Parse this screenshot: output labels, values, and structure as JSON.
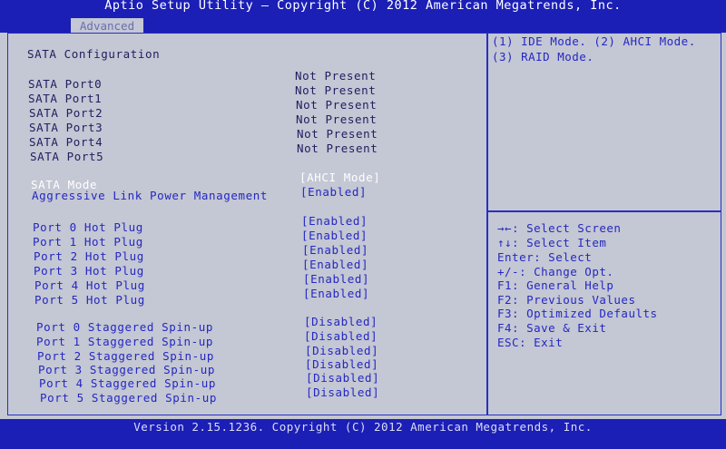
{
  "header": {
    "title": "Aptio Setup Utility – Copyright (C) 2012 American Megatrends, Inc.",
    "tab": "Advanced"
  },
  "main": {
    "section_title": "SATA Configuration",
    "ports": [
      {
        "label": "SATA Port0",
        "value": "Not Present"
      },
      {
        "label": "SATA Port1",
        "value": "Not Present"
      },
      {
        "label": "SATA Port2",
        "value": "Not Present"
      },
      {
        "label": "SATA Port3",
        "value": "Not Present"
      },
      {
        "label": "SATA Port4",
        "value": "Not Present"
      },
      {
        "label": "SATA Port5",
        "value": "Not Present"
      }
    ],
    "sata_mode": {
      "label": "SATA Mode",
      "value": "[AHCI Mode]"
    },
    "alpm": {
      "label": "Aggressive Link Power Management",
      "value": "[Enabled]"
    },
    "hot_plug": [
      {
        "label": "Port 0 Hot Plug",
        "value": "[Enabled]"
      },
      {
        "label": "Port 1 Hot Plug",
        "value": "[Enabled]"
      },
      {
        "label": "Port 2 Hot Plug",
        "value": "[Enabled]"
      },
      {
        "label": "Port 3 Hot Plug",
        "value": "[Enabled]"
      },
      {
        "label": "Port 4 Hot Plug",
        "value": "[Enabled]"
      },
      {
        "label": "Port 5 Hot Plug",
        "value": "[Enabled]"
      }
    ],
    "spin_up": [
      {
        "label": "Port 0 Staggered Spin-up",
        "value": "[Disabled]"
      },
      {
        "label": "Port 1 Staggered Spin-up",
        "value": "[Disabled]"
      },
      {
        "label": "Port 2 Staggered Spin-up",
        "value": "[Disabled]"
      },
      {
        "label": "Port 3 Staggered Spin-up",
        "value": "[Disabled]"
      },
      {
        "label": "Port 4 Staggered Spin-up",
        "value": "[Disabled]"
      },
      {
        "label": "Port 5 Staggered Spin-up",
        "value": "[Disabled]"
      }
    ]
  },
  "help": {
    "lines": [
      "(1) IDE Mode. (2) AHCI Mode.",
      "(3) RAID Mode."
    ]
  },
  "keys": [
    "→←: Select Screen",
    "↑↓: Select Item",
    "Enter: Select",
    "+/-: Change Opt.",
    "F1: General Help",
    "F2: Previous Values",
    "F3: Optimized Defaults",
    "F4: Save & Exit",
    "ESC: Exit"
  ],
  "footer": {
    "version": "Version 2.15.1236. Copyright (C) 2012 American Megatrends, Inc."
  },
  "colors": {
    "bar": "#1b1fb5",
    "background": "#c4c7d4",
    "text_dark": "#202060",
    "text_blue": "#2428c0",
    "highlight": "#ffffff"
  }
}
